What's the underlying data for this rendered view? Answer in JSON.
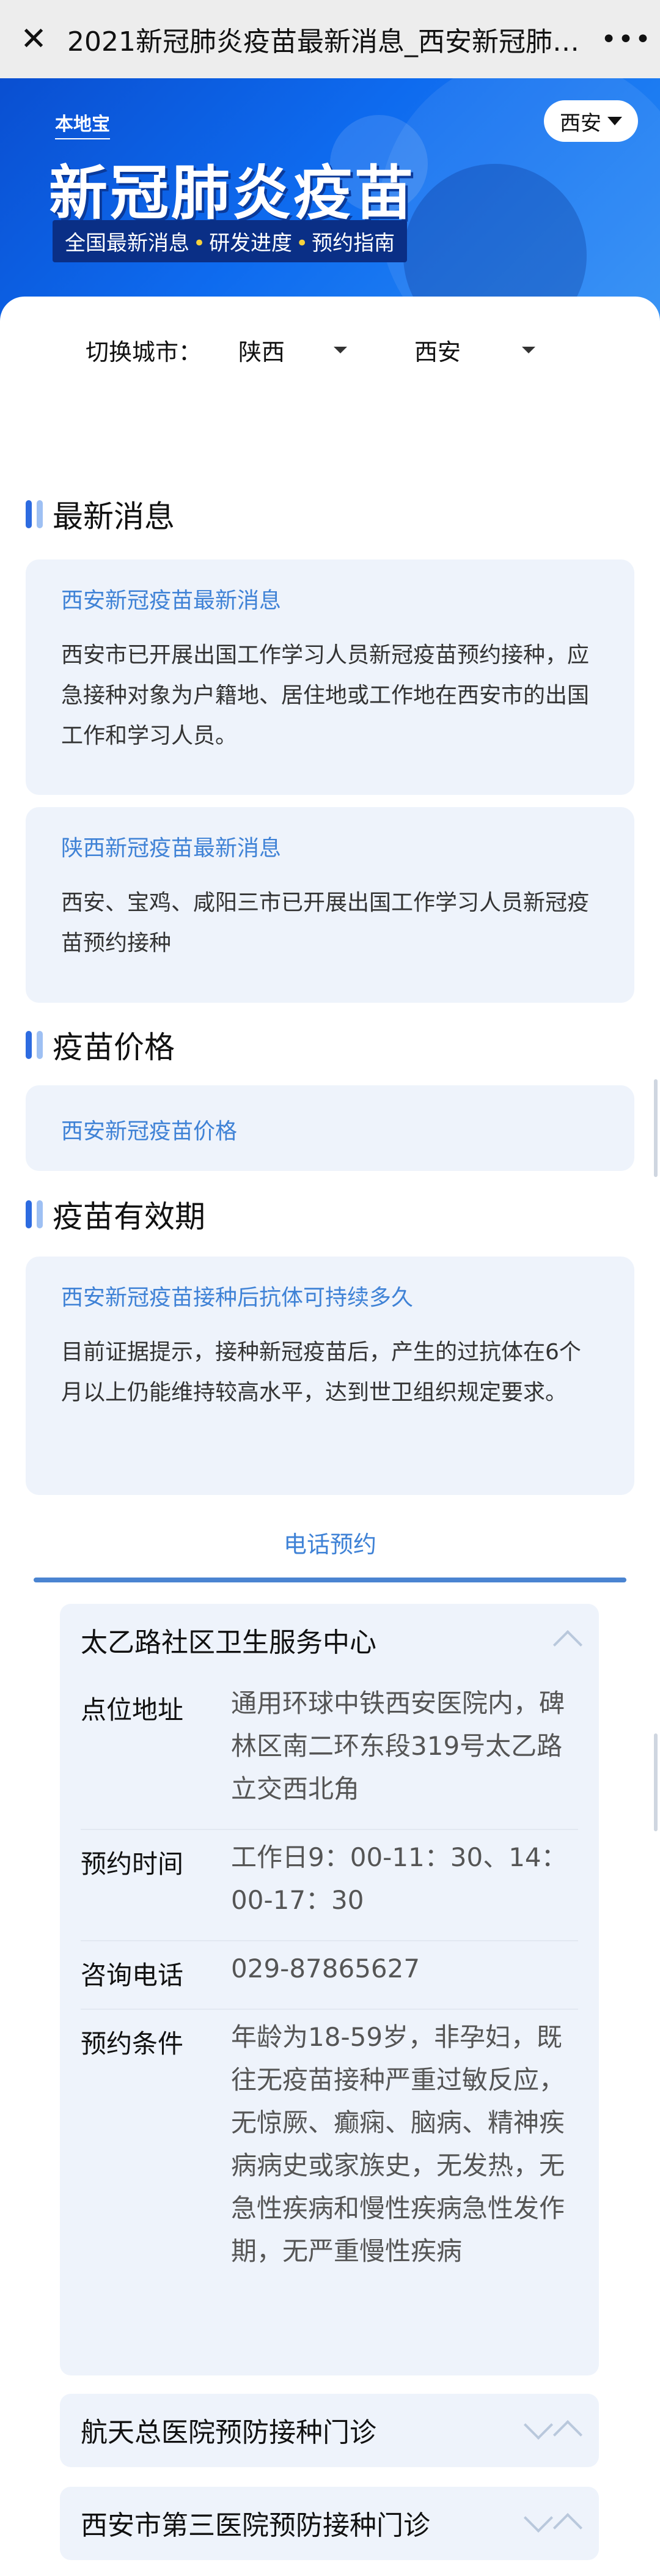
{
  "topbar": {
    "close_glyph": "✕",
    "title": "2021新冠肺炎疫苗最新消息_西安新冠肺…",
    "more_glyph": "•••"
  },
  "banner": {
    "logo": "本地宝",
    "headline": "新冠肺炎疫苗",
    "subline_parts": [
      "全国最新消息",
      "研发进度",
      "预约指南"
    ],
    "subline_sep": "•",
    "city": "西安"
  },
  "city_switch": {
    "label": "切换城市：",
    "province": "陕西",
    "city": "西安"
  },
  "sections": {
    "news": {
      "title": "最新消息",
      "cards": [
        {
          "title": "西安新冠疫苗最新消息",
          "body": "西安市已开展出国工作学习人员新冠疫苗预约接种，应急接种对象为户籍地、居住地或工作地在西安市的出国工作和学习人员。"
        },
        {
          "title": "陕西新冠疫苗最新消息",
          "body": "西安、宝鸡、咸阳三市已开展出国工作学习人员新冠疫苗预约接种"
        }
      ]
    },
    "price": {
      "title": "疫苗价格",
      "card_title": "西安新冠疫苗价格"
    },
    "validity": {
      "title": "疫苗有效期",
      "card_title": "西安新冠疫苗接种后抗体可持续多久",
      "card_body": "目前证据提示，接种新冠疫苗后，产生的过抗体在6个月以上仍能维持较高水平，达到世卫组织规定要求。"
    }
  },
  "phone_tab": "电话预约",
  "clinics": [
    {
      "name": "太乙路社区卫生服务中心",
      "expanded": true,
      "rows": [
        {
          "label": "点位地址",
          "value": "通用环球中铁西安医院内，碑林区南二环东段319号太乙路立交西北角"
        },
        {
          "label": "预约时间",
          "value": "工作日9：00-11：30、14：00-17：30"
        },
        {
          "label": "咨询电话",
          "value": "029-87865627"
        },
        {
          "label": "预约条件",
          "value": "年龄为18-59岁，非孕妇，既往无疫苗接种严重过敏反应，无惊厥、癫痫、脑病、精神疾病病史或家族史，无发热，无急性疾病和慢性疾病急性发作期，无严重慢性疾病"
        }
      ]
    },
    {
      "name": "航天总医院预防接种门诊",
      "expanded": false
    },
    {
      "name": "西安市第三医院预防接种门诊",
      "expanded": false
    }
  ],
  "colors": {
    "accent": "#3f82d6",
    "card_bg": "#eef3fb",
    "banner_blue": "#0e6bef"
  }
}
